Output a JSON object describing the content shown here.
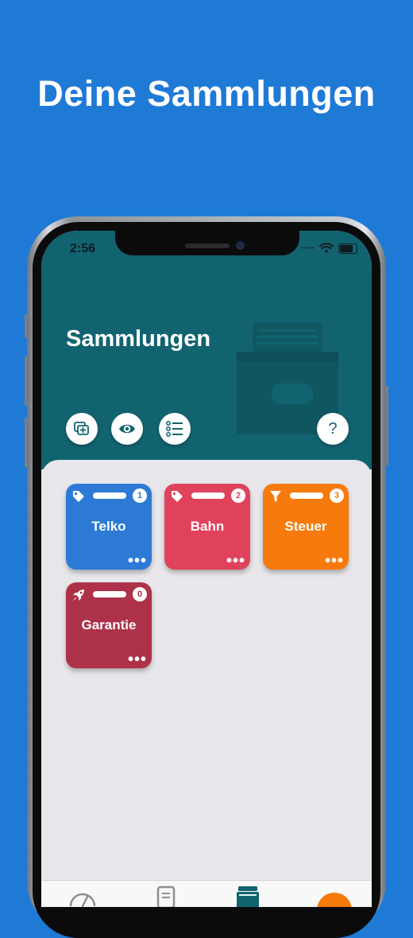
{
  "promo": {
    "title": "Deine Sammlungen"
  },
  "status_bar": {
    "time": "2:56",
    "signal": "•••••"
  },
  "header": {
    "title": "Sammlungen",
    "help_glyph": "?",
    "buttons": [
      {
        "name": "add-collection",
        "icon": "collection-add-icon"
      },
      {
        "name": "view",
        "icon": "eye-icon"
      },
      {
        "name": "list",
        "icon": "checklist-icon"
      },
      {
        "name": "help",
        "icon": "question-icon"
      }
    ]
  },
  "collections": [
    {
      "name": "Telko",
      "count": "1",
      "icon": "tag-icon",
      "color": "#2c7ad6",
      "more": "•••"
    },
    {
      "name": "Bahn",
      "count": "2",
      "icon": "tag-icon",
      "color": "#e0425c",
      "more": "•••"
    },
    {
      "name": "Steuer",
      "count": "3",
      "icon": "filter-icon",
      "color": "#f77a0c",
      "more": "•••"
    },
    {
      "name": "Garantie",
      "count": "0",
      "icon": "rocket-icon",
      "color": "#ad3249",
      "more": "•••"
    }
  ],
  "tabbar": {
    "items": [
      {
        "icon": "speedometer-icon"
      },
      {
        "icon": "documents-icon"
      },
      {
        "icon": "archive-box-icon",
        "active": true
      },
      {
        "icon": "orange-action-icon",
        "color": "#f77a0c"
      }
    ]
  },
  "colors": {
    "background": "#1f7ad6",
    "header": "#126370",
    "sheet": "#e7e6ea"
  }
}
